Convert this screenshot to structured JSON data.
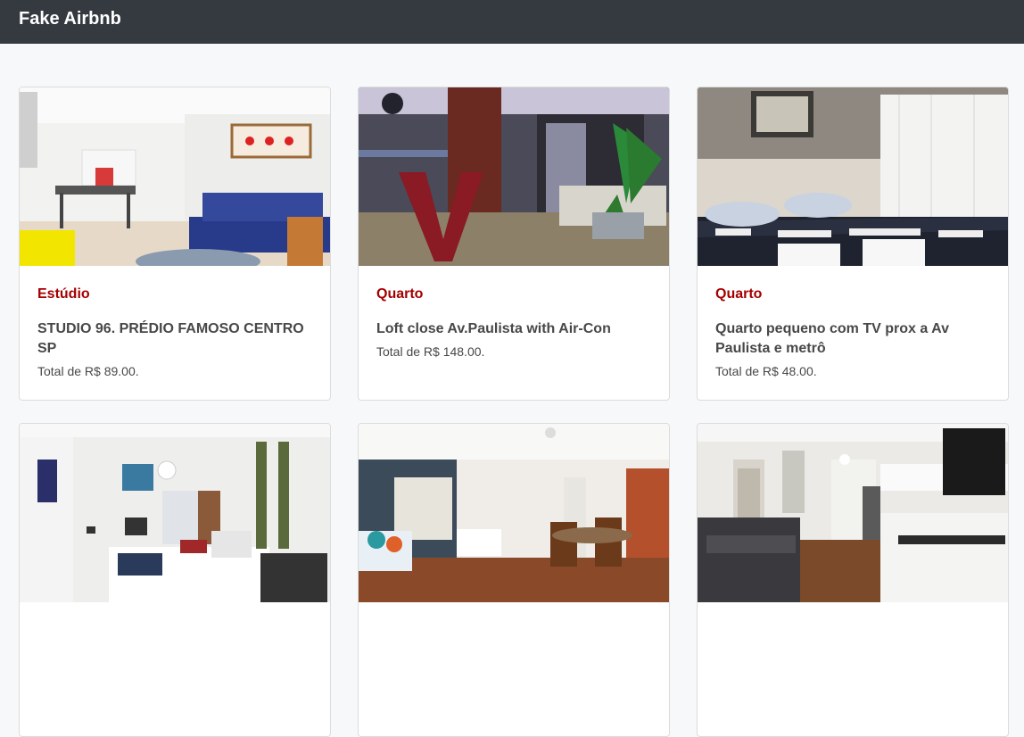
{
  "navbar": {
    "brand": "Fake Airbnb"
  },
  "listings": [
    {
      "type": "Estúdio",
      "name": "STUDIO 96. PRÉDIO FAMOSO CENTRO SP",
      "price": "Total de R$ 89.00."
    },
    {
      "type": "Quarto",
      "name": "Loft close Av.Paulista with Air-Con",
      "price": "Total de R$ 148.00."
    },
    {
      "type": "Quarto",
      "name": "Quarto pequeno com TV prox a Av Paulista e metrô",
      "price": "Total de R$ 48.00."
    },
    {
      "type": "",
      "name": "",
      "price": ""
    },
    {
      "type": "",
      "name": "",
      "price": ""
    },
    {
      "type": "",
      "name": "",
      "price": ""
    }
  ]
}
